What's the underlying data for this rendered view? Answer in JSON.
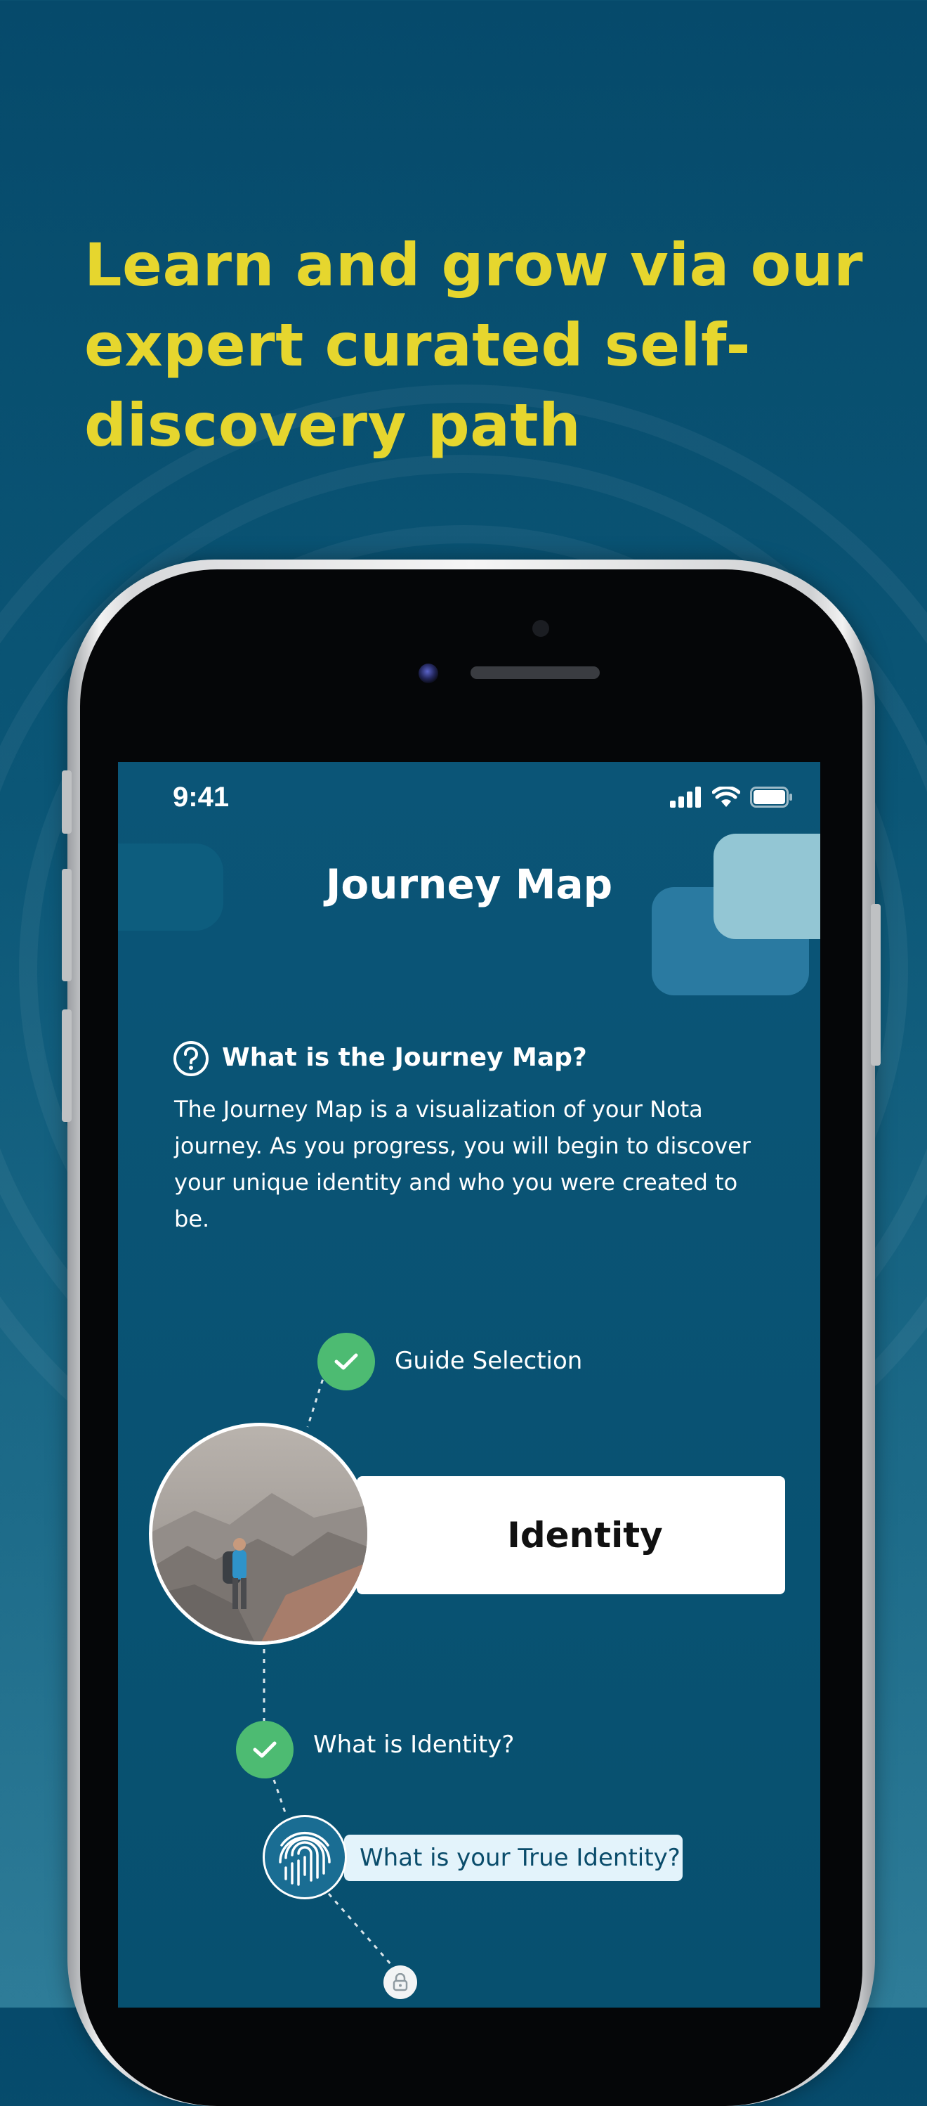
{
  "headline": "Learn and grow via our expert curated self-discovery path",
  "status_bar": {
    "time": "9:41",
    "icons": [
      "cellular-signal-icon",
      "wifi-icon",
      "battery-icon"
    ]
  },
  "screen": {
    "title": "Journey Map",
    "info": {
      "icon": "question-circle-icon",
      "heading": "What is the Journey Map?",
      "body": "The Journey Map is a visualization of your Nota journey. As you progress, you will begin to discover your unique identity and who you were created to be."
    },
    "steps": [
      {
        "label": "Guide Selection",
        "status": "completed",
        "icon": "check-icon"
      },
      {
        "label": "Identity",
        "status": "current",
        "image": "hiker-on-mountain-photo"
      },
      {
        "label": "What is Identity?",
        "status": "completed",
        "icon": "check-icon"
      },
      {
        "label": "What is your True Identity?",
        "status": "active",
        "icon": "fingerprint-icon"
      },
      {
        "label": "",
        "status": "locked",
        "icon": "lock-icon"
      }
    ]
  },
  "colors": {
    "background": "#0b5676",
    "headline": "#e6d62e",
    "check": "#4dbb72",
    "card": "#ffffff",
    "chip": "#e3f3fb"
  }
}
